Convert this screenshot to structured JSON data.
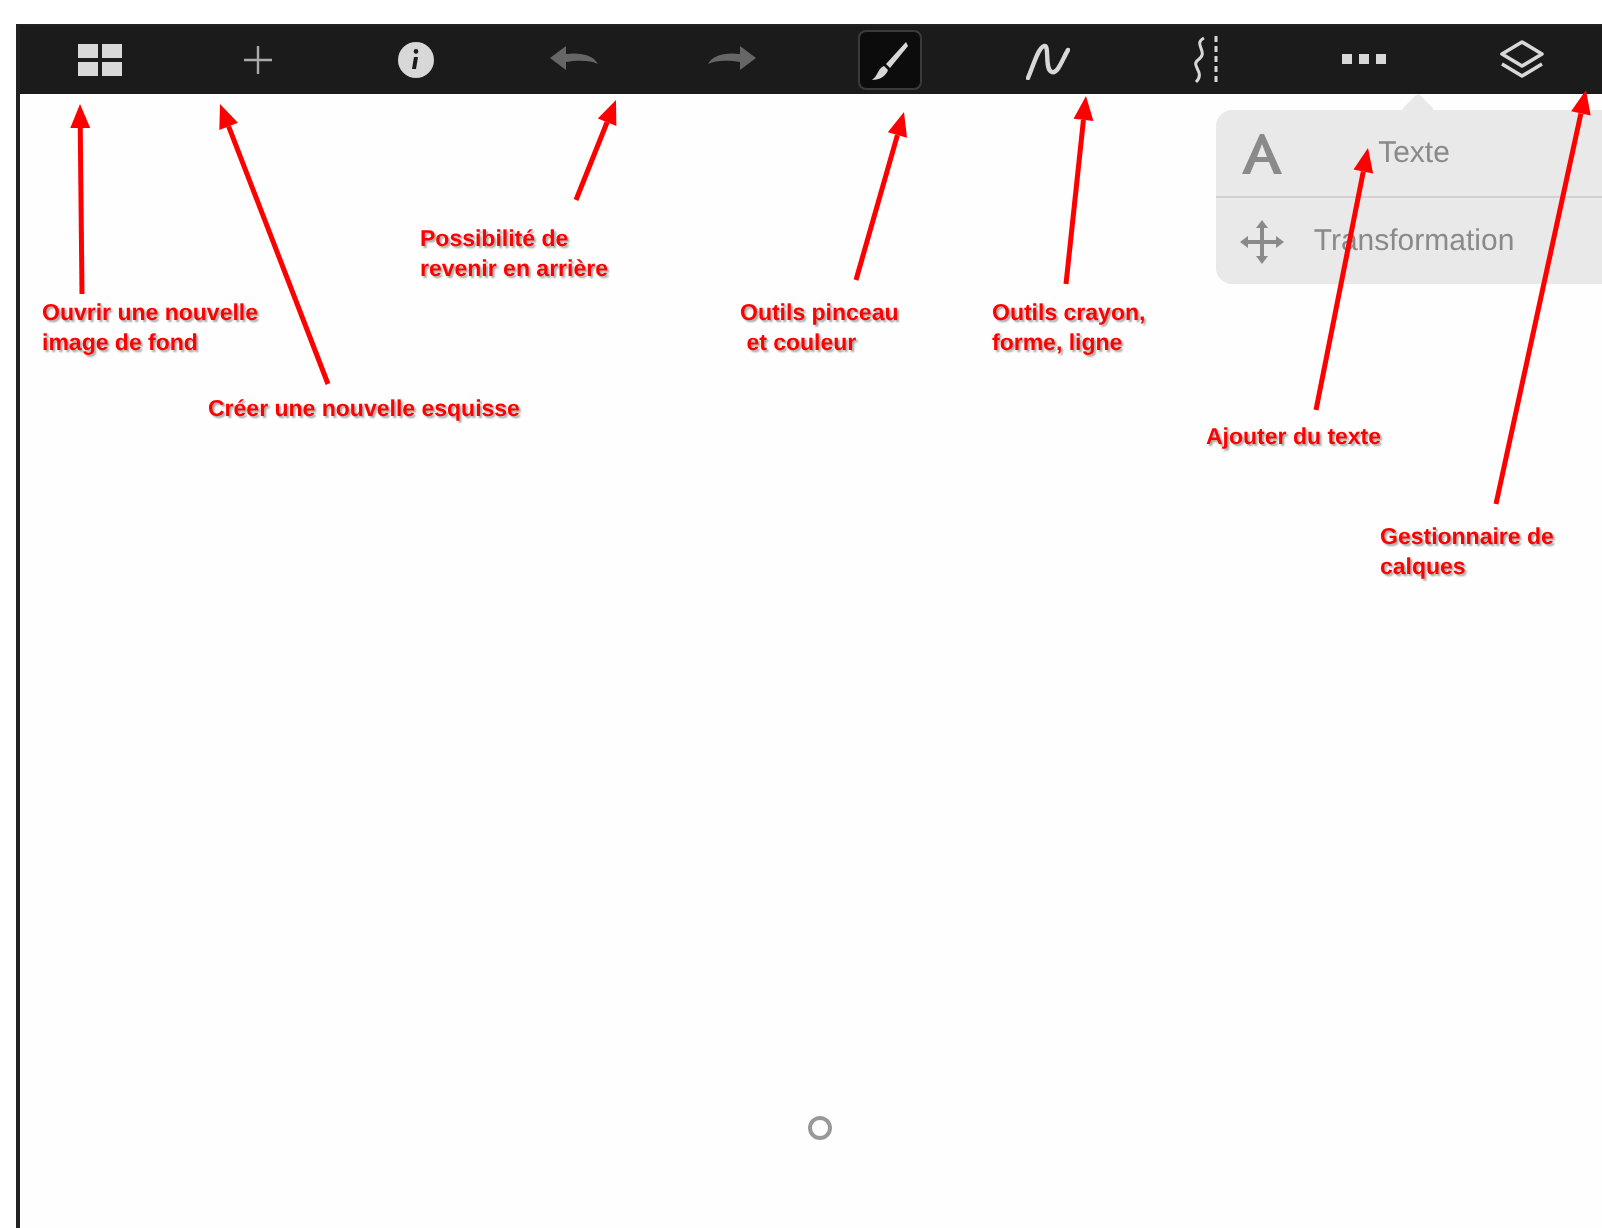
{
  "toolbar": {
    "items": [
      {
        "kind": "grid",
        "selected": false,
        "disabled": false
      },
      {
        "kind": "plus",
        "selected": false,
        "disabled": false
      },
      {
        "kind": "info",
        "selected": false,
        "disabled": false
      },
      {
        "kind": "undo",
        "selected": false,
        "disabled": true
      },
      {
        "kind": "redo",
        "selected": false,
        "disabled": true
      },
      {
        "kind": "brush",
        "selected": true,
        "disabled": false
      },
      {
        "kind": "pen",
        "selected": false,
        "disabled": false
      },
      {
        "kind": "ruler",
        "selected": false,
        "disabled": false
      },
      {
        "kind": "more",
        "selected": false,
        "disabled": false
      },
      {
        "kind": "layers",
        "selected": false,
        "disabled": false
      }
    ]
  },
  "menu": {
    "items": [
      {
        "kind": "text",
        "label": "Texte"
      },
      {
        "kind": "move",
        "label": "Transformation"
      }
    ]
  },
  "annotations": [
    "Ouvrir une nouvelle\nimage de fond",
    "Créer une nouvelle esquisse",
    "Possibilité de\nrevenir en arrière",
    "Outils pinceau\n et couleur",
    "Outils crayon,\nforme, ligne",
    "Ajouter du texte",
    "Gestionnaire de\ncalques"
  ]
}
